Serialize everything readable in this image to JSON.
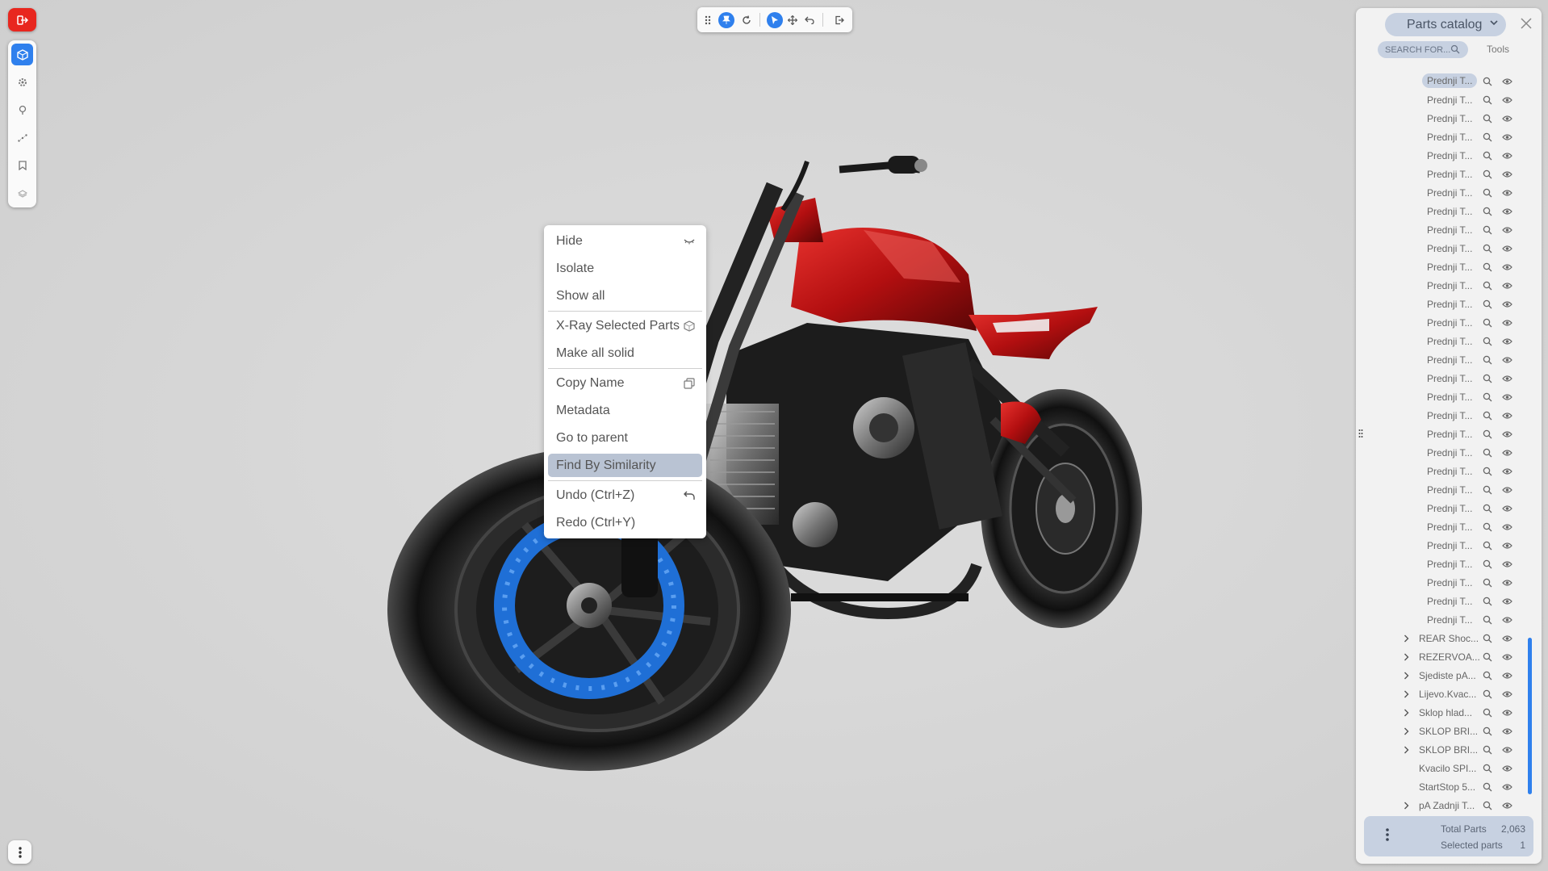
{
  "viewer": {
    "exit_icon": "exit-icon",
    "left_toolbar": [
      "parts-catalog-icon",
      "gear-icon",
      "pin-icon",
      "measure-icon",
      "bookmark-icon",
      "layers-icon"
    ],
    "more_icon": "vertical-dots-icon"
  },
  "top_toolbar": {
    "items": [
      "drag-handle-icon",
      "pin-icon",
      "rotate-icon",
      "select-icon",
      "move-icon",
      "undo-icon",
      "exit-icon"
    ]
  },
  "context_menu": {
    "hide": "Hide",
    "isolate": "Isolate",
    "show_all": "Show all",
    "xray": "X-Ray Selected Parts",
    "make_solid": "Make all solid",
    "copy_name": "Copy Name",
    "metadata": "Metadata",
    "go_parent": "Go to parent",
    "find_similarity": "Find By Similarity",
    "undo": "Undo (Ctrl+Z)",
    "redo": "Redo (Ctrl+Y)"
  },
  "panel": {
    "title": "Parts catalog",
    "search_placeholder": "SEARCH FOR...",
    "tools": "Tools",
    "tree": [
      {
        "label": "Prednji T...",
        "selected": true,
        "expandable": false
      },
      {
        "label": "Prednji T...",
        "expandable": false
      },
      {
        "label": "Prednji T...",
        "expandable": false
      },
      {
        "label": "Prednji T...",
        "expandable": false
      },
      {
        "label": "Prednji T...",
        "expandable": false
      },
      {
        "label": "Prednji T...",
        "expandable": false
      },
      {
        "label": "Prednji T...",
        "expandable": false
      },
      {
        "label": "Prednji T...",
        "expandable": false
      },
      {
        "label": "Prednji T...",
        "expandable": false
      },
      {
        "label": "Prednji T...",
        "expandable": false
      },
      {
        "label": "Prednji T...",
        "expandable": false
      },
      {
        "label": "Prednji T...",
        "expandable": false
      },
      {
        "label": "Prednji T...",
        "expandable": false
      },
      {
        "label": "Prednji T...",
        "expandable": false
      },
      {
        "label": "Prednji T...",
        "expandable": false
      },
      {
        "label": "Prednji T...",
        "expandable": false
      },
      {
        "label": "Prednji T...",
        "expandable": false
      },
      {
        "label": "Prednji T...",
        "expandable": false
      },
      {
        "label": "Prednji T...",
        "expandable": false
      },
      {
        "label": "Prednji T...",
        "expandable": false
      },
      {
        "label": "Prednji T...",
        "expandable": false
      },
      {
        "label": "Prednji T...",
        "expandable": false
      },
      {
        "label": "Prednji T...",
        "expandable": false
      },
      {
        "label": "Prednji T...",
        "expandable": false
      },
      {
        "label": "Prednji T...",
        "expandable": false
      },
      {
        "label": "Prednji T...",
        "expandable": false
      },
      {
        "label": "Prednji T...",
        "expandable": false
      },
      {
        "label": "Prednji T...",
        "expandable": false
      },
      {
        "label": "Prednji T...",
        "expandable": false
      },
      {
        "label": "Prednji T...",
        "expandable": false
      },
      {
        "label": "REAR Shoc...",
        "expandable": true
      },
      {
        "label": "REZERVOA...",
        "expandable": true
      },
      {
        "label": "Sjediste pA...",
        "expandable": true
      },
      {
        "label": "Lijevo.Kvac...",
        "expandable": true
      },
      {
        "label": "Sklop hlad...",
        "expandable": true
      },
      {
        "label": "SKLOP BRI...",
        "expandable": true
      },
      {
        "label": "SKLOP BRI...",
        "expandable": true
      },
      {
        "label": "Kvacilo SPI...",
        "expandable": false
      },
      {
        "label": "StartStop 5...",
        "expandable": false
      },
      {
        "label": "pA Zadnji T...",
        "expandable": true
      }
    ],
    "footer": {
      "total_label": "Total Parts",
      "total_value": "2,063",
      "selected_label": "Selected parts",
      "selected_value": "1"
    }
  },
  "colors": {
    "accent": "#2f80ed",
    "exit_red": "#e8271f",
    "panel_chip": "#c7d1e1",
    "menu_highlight": "#b9c3d3",
    "bike_red": "#c01414"
  }
}
